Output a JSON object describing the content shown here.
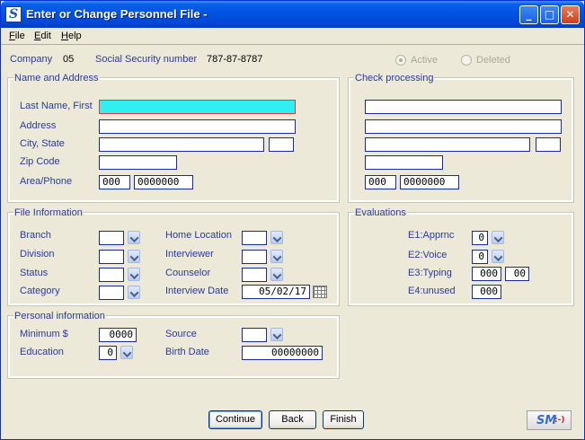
{
  "window": {
    "title": "Enter or Change Personnel File -",
    "app_icon": "S"
  },
  "menu": [
    {
      "key": "F",
      "rest": "ile"
    },
    {
      "key": "E",
      "rest": "dit"
    },
    {
      "key": "H",
      "rest": "elp"
    }
  ],
  "header": {
    "company_label": "Company",
    "company_value": "05",
    "ssn_label": "Social Security number",
    "ssn_value": "787-87-8787",
    "active_label": "Active",
    "deleted_label": "Deleted"
  },
  "name_address": {
    "title": "Name and Address",
    "last_first_label": "Last Name, First",
    "last_first_value": "",
    "address_label": "Address",
    "address_value": "",
    "city_state_label": "City, State",
    "city_value": "",
    "state_value": "",
    "zip_label": "Zip Code",
    "zip_value": "",
    "area_phone_label": "Area/Phone",
    "area_value": "000",
    "phone_value": "0000000"
  },
  "check_processing": {
    "title": "Check processing",
    "line1": "",
    "line2": "",
    "city": "",
    "state": "",
    "zip": "",
    "area_value": "000",
    "phone_value": "0000000"
  },
  "file_info": {
    "title": "File Information",
    "branch_label": "Branch",
    "division_label": "Division",
    "status_label": "Status",
    "category_label": "Category",
    "home_location_label": "Home Location",
    "interviewer_label": "Interviewer",
    "counselor_label": "Counselor",
    "interview_date_label": "Interview Date",
    "interview_date_value": "05/02/17"
  },
  "evaluations": {
    "title": "Evaluations",
    "e1_label": "E1:Apprnc",
    "e1_value": "0",
    "e2_label": "E2:Voice",
    "e2_value": "0",
    "e3_label": "E3:Typing",
    "e3_value_a": "000",
    "e3_value_b": "00",
    "e4_label": "E4:unused",
    "e4_value": "000"
  },
  "personal": {
    "title": "Personal information",
    "minimum_label": "Minimum $",
    "minimum_value": "0000",
    "education_label": "Education",
    "education_value": "0",
    "source_label": "Source",
    "birth_date_label": "Birth Date",
    "birth_date_value": "00000000"
  },
  "buttons": {
    "continue": "Continue",
    "back": "Back",
    "finish": "Finish"
  },
  "logo": {
    "text": "SM",
    "suffix": ":-)"
  }
}
